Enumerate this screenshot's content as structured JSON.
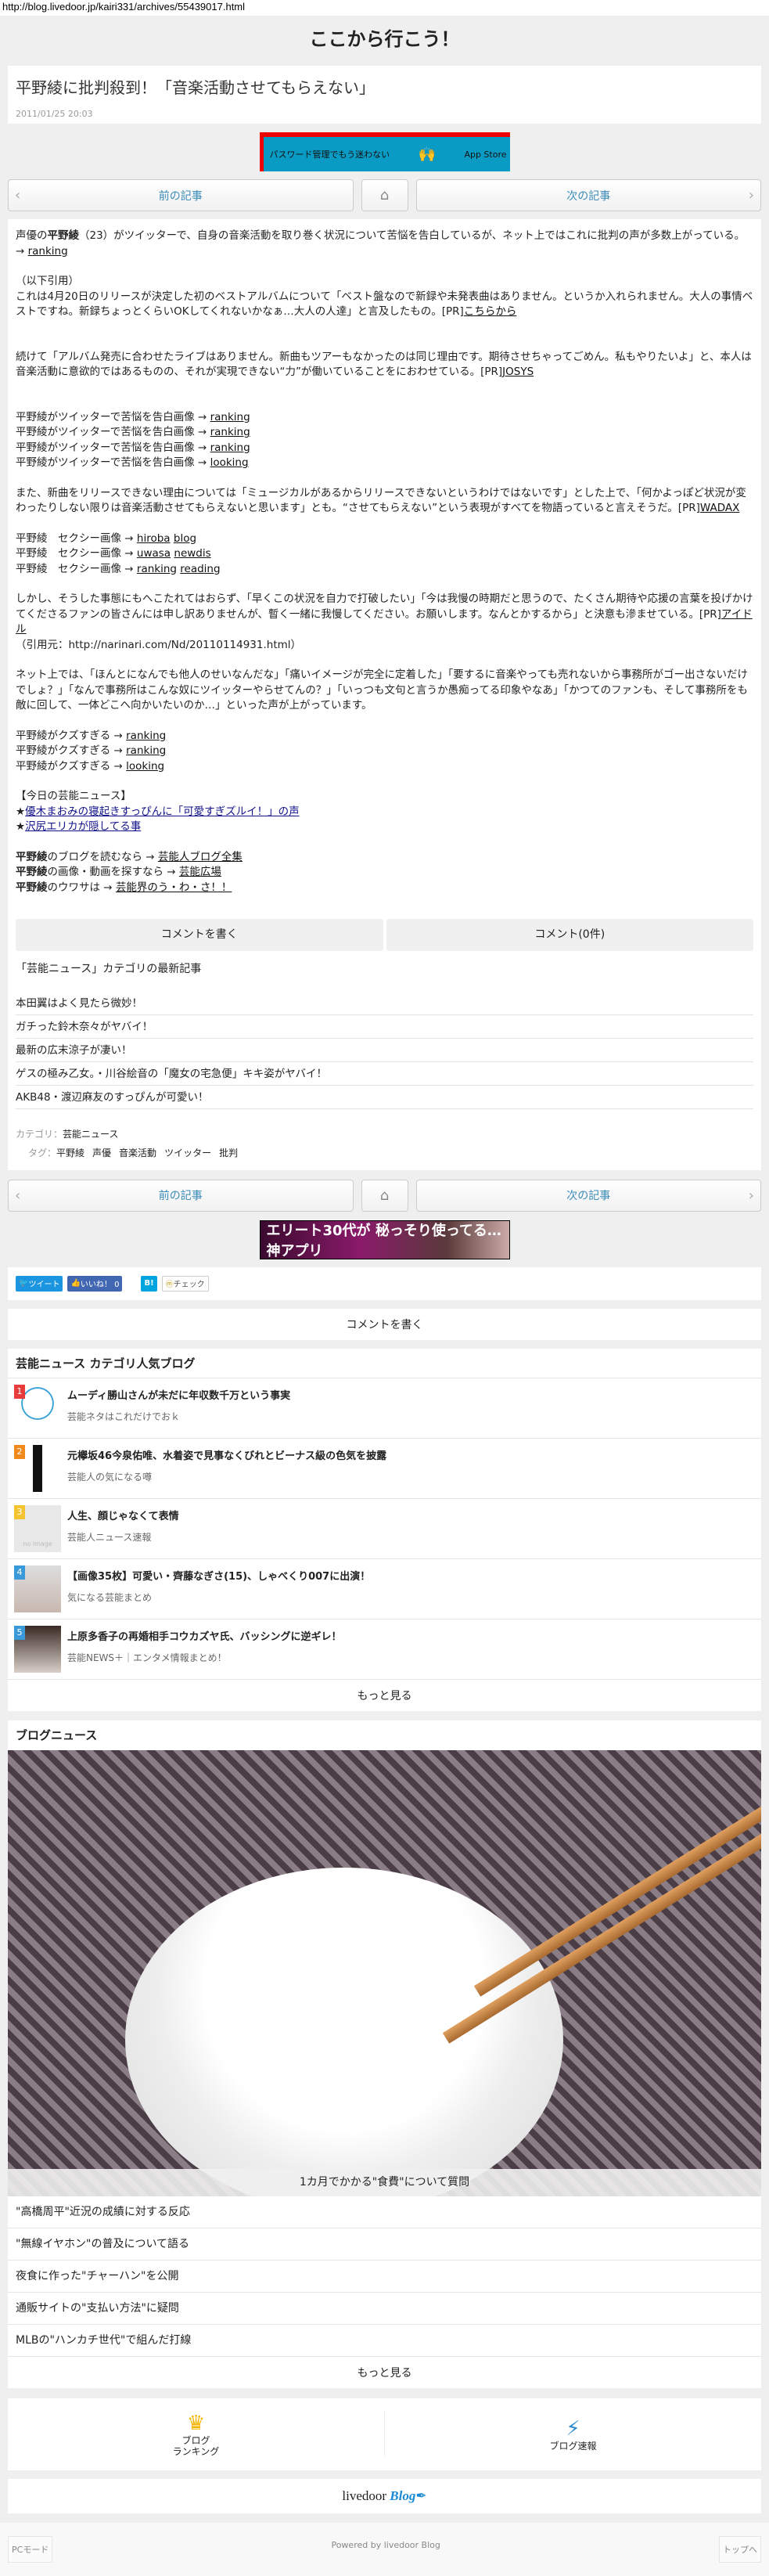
{
  "url": "http://blog.livedoor.jp/kairi331/archives/55439017.html",
  "site_title": "ここから行こう！",
  "article": {
    "title": "平野綾に批判殺到！「音楽活動させてもらえない」",
    "date": "2011/01/25 20:03"
  },
  "ad1": {
    "text": "パスワード管理でもう迷わない",
    "store": "App Store"
  },
  "nav": {
    "prev": "前の記事",
    "next": "次の記事"
  },
  "body": {
    "p1_pre": "声優の",
    "p1_name": "平野綾",
    "p1_post": "（23）がツイッターで、自身の音楽活動を取り巻く状況について苦悩を告白しているが、ネット上ではこれに批判の声が多数上がっている。→ ",
    "p1_link": "ranking",
    "quote_head": "（以下引用）",
    "p2": "これは4月20日のリリースが決定した初のベストアルバムについて「ベスト盤なので新録や未発表曲はありません。というか入れられません。大人の事情ベストですね。新録ちょっとくらいOKしてくれないかなぁ…大人の人達」と言及したもの。[PR]",
    "p2_link": "こちらから",
    "p3": "続けて「アルバム発売に合わせたライブはありません。新曲もツアーもなかったのは同じ理由です。期待させちゃってごめん。私もやりたいよ」と、本人は音楽活動に意欲的ではあるものの、それが実現できない“力”が働いていることをにおわせている。[PR]",
    "p3_link": "JOSYS",
    "links1": [
      {
        "t": "平野綾がツイッターで苦悩を告白画像 → ",
        "l": "ranking"
      },
      {
        "t": "平野綾がツイッターで苦悩を告白画像 → ",
        "l": "ranking"
      },
      {
        "t": "平野綾がツイッターで苦悩を告白画像 → ",
        "l": "ranking"
      },
      {
        "t": "平野綾がツイッターで苦悩を告白画像 → ",
        "l": "looking"
      }
    ],
    "p4": "また、新曲をリリースできない理由については「ミュージカルがあるからリリースできないというわけではないです」とした上で、「何かよっぽど状況が変わったりしない限りは音楽活動させてもらえないと思います」とも。“させてもらえない”という表現がすべてを物語っていると言えそうだ。[PR]",
    "p4_link": "WADAX",
    "links2": [
      {
        "t": "平野綾　セクシー画像 → ",
        "l1": "hiroba",
        "l2": "blog"
      },
      {
        "t": "平野綾　セクシー画像 → ",
        "l1": "uwasa",
        "l2": "newdis"
      },
      {
        "t": "平野綾　セクシー画像 → ",
        "l1": "ranking",
        "l2": "reading"
      }
    ],
    "p5": "しかし、そうした事態にもへこたれてはおらず、「早くこの状況を自力で打破したい」「今は我慢の時期だと思うので、たくさん期待や応援の言葉を投げかけてくださるファンの皆さんには申し訳ありませんが、暫く一緒に我慢してください。お願いします。なんとかするから」と決意も滲ませている。[PR]",
    "p5_link": "アイドル",
    "source": "（引用元：http://narinari.com/Nd/20110114931.html）",
    "p6": "ネット上では、「ほんとになんでも他人のせいなんだな」「痛いイメージが完全に定着した」「要するに音楽やっても売れないから事務所がゴー出さないだけでしょ？」「なんで事務所はこんな奴にツイッターやらせてんの？」「いっつも文句と言うか愚痴ってる印象やなあ」「かつてのファンも、そして事務所をも敵に回して、一体どこへ向かいたいのか…」といった声が上がっています。",
    "links3": [
      {
        "t": "平野綾がクズすぎる → ",
        "l": "ranking"
      },
      {
        "t": "平野綾がクズすぎる → ",
        "l": "ranking"
      },
      {
        "t": "平野綾がクズすぎる → ",
        "l": "looking"
      }
    ],
    "news_head": "【今日の芸能ニュース】",
    "news": [
      "優木まおみの寝起きすっぴんに「可愛すぎズルイ！」の声",
      "沢尻エリカが隠してる事"
    ],
    "links4": [
      {
        "b": "平野綾",
        "t": "のブログを読むなら → ",
        "l": "芸能人ブログ全集"
      },
      {
        "b": "平野綾",
        "t": "の画像・動画を探すなら → ",
        "l": "芸能広場"
      },
      {
        "b": "平野綾",
        "t": "のウワサは → ",
        "l": "芸能界のう・わ・さ！！"
      }
    ]
  },
  "comment": {
    "write": "コメントを書く",
    "count": "コメント(0件)"
  },
  "latest": {
    "title": "「芸能ニュース」カテゴリの最新記事",
    "items": [
      "本田翼はよく見たら微妙！",
      "ガチった鈴木奈々がヤバイ！",
      "最新の広末涼子が凄い！",
      "ゲスの極み乙女。・川谷絵音の「魔女の宅急便」キキ姿がヤバイ！",
      "AKB48・渡辺麻友のすっぴんが可愛い！"
    ]
  },
  "meta": {
    "cat_label": "カテゴリ：",
    "cat": "芸能ニュース",
    "tag_label": "タグ：",
    "tags": [
      "平野綾",
      "声優",
      "音楽活動",
      "ツイッター",
      "批判"
    ]
  },
  "ad2": {
    "text": "エリート30代が 秘っそり使ってる… 神アプリ"
  },
  "share": {
    "tweet": "ツイート",
    "like": "いいね！ 0",
    "hatena": "B!",
    "check": "チェック"
  },
  "write_comment": "コメントを書く",
  "popular": {
    "title": "芸能ニュース カテゴリ人気ブログ",
    "items": [
      {
        "rank": "1",
        "title": "ムーディ勝山さんが未だに年収数千万という事実",
        "blog": "芸能ネタはこれだけでおｋ",
        "color": "#e83c3c"
      },
      {
        "rank": "2",
        "title": "元欅坂46今泉佑唯、水着姿で見事なくびれとビーナス級の色気を披露",
        "blog": "芸能人の気になる噂",
        "color": "#f08a1c"
      },
      {
        "rank": "3",
        "title": "人生、顔じゃなくて表情",
        "blog": "芸能人ニュース速報",
        "color": "#f4c430",
        "noimage": "no image"
      },
      {
        "rank": "4",
        "title": "【画像35枚】可愛い・齊藤なぎさ(15)、しゃべくり007に出演！",
        "blog": "気になる芸能まとめ",
        "color": "#3a9ad9"
      },
      {
        "rank": "5",
        "title": "上原多香子の再婚相手コウカズヤ氏、バッシングに逆ギレ！",
        "blog": "芸能NEWS＋｜エンタメ情報まとめ！",
        "color": "#3a9ad9"
      }
    ],
    "more": "もっと見る"
  },
  "blognews": {
    "title": "ブログニュース",
    "caption": "1カ月でかかる\"食費\"について質問",
    "items": [
      "\"高橋周平\"近況の成績に対する反応",
      "\"無線イヤホン\"の普及について語る",
      "夜食に作った\"チャーハン\"を公開",
      "通販サイトの\"支払い方法\"に疑問",
      "MLBの\"ハンカチ世代\"で組んだ打線"
    ],
    "more": "もっと見る"
  },
  "links": {
    "ranking": "ブログ\nランキング",
    "ranking1": "ブログ",
    "ranking2": "ランキング",
    "flash": "ブログ速報"
  },
  "logo": {
    "a": "livedoor",
    "b": "Blog"
  },
  "footer": {
    "pc": "PCモード",
    "powered": "Powered by livedoor Blog",
    "top": "トップへ"
  }
}
